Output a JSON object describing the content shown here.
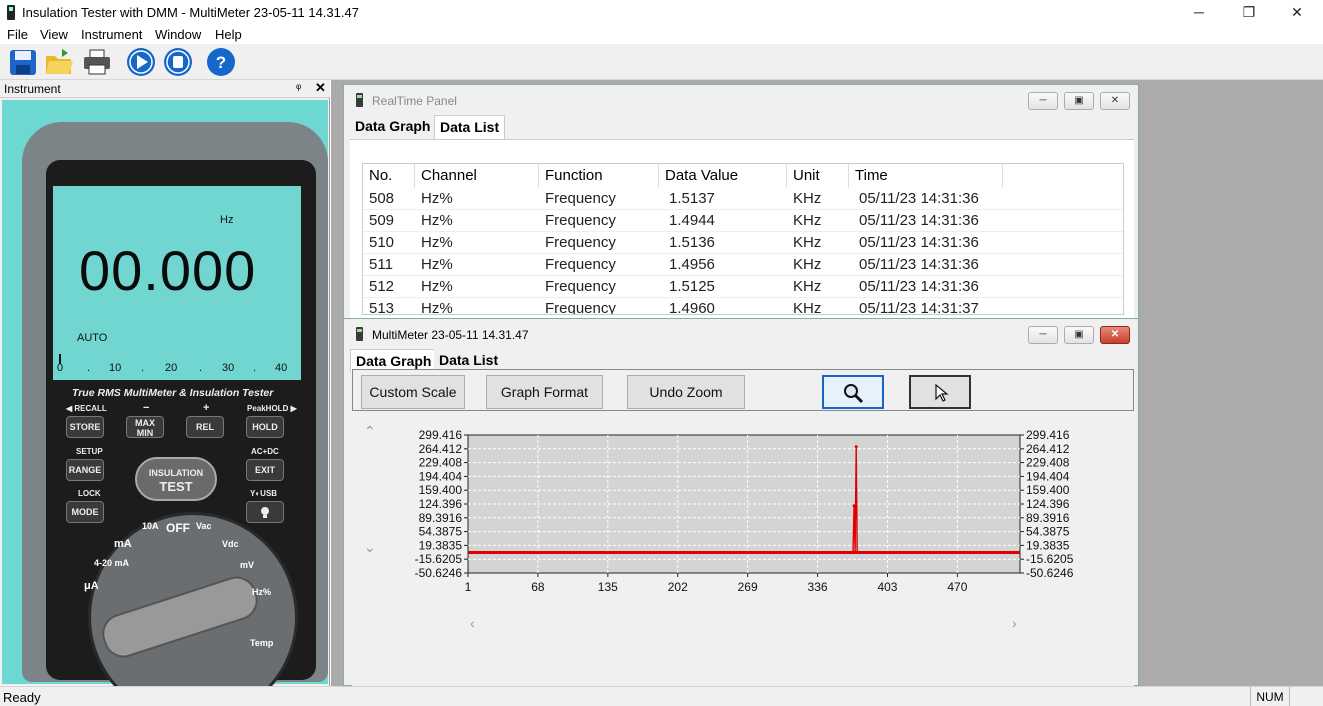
{
  "window": {
    "title": "Insulation Tester with DMM - MultiMeter 23-05-11  14.31.47",
    "minimize": "─",
    "maximize": "❐",
    "close": "✕"
  },
  "menu": [
    "File",
    "View",
    "Instrument",
    "Window",
    "Help"
  ],
  "toolbar_icons": [
    "save-icon",
    "open-folder-icon",
    "print-icon",
    "play-icon",
    "stop-icon",
    "help-icon"
  ],
  "instrument_pane": {
    "title": "Instrument",
    "pin": "ᵠ",
    "close": "✕",
    "lcd": {
      "unit": "Hz",
      "reading": "00.000",
      "mode": "AUTO",
      "scale": [
        "0",
        ".",
        "10",
        ".",
        "20",
        ".",
        "30",
        ".",
        "40"
      ]
    },
    "brand": "True RMS MultiMeter & Insulation Tester",
    "labels": {
      "recall": "◀ RECALL",
      "minus": "−",
      "plus": "+",
      "peakhold": "PeakHOLD ▶",
      "setup": "SETUP",
      "acdc": "AC+DC",
      "lock": "LOCK",
      "usb": "Y◐USB"
    },
    "buttons": {
      "store": "STORE",
      "maxmin": "MAX MIN",
      "rel": "REL",
      "hold": "HOLD",
      "range": "RANGE",
      "exit": "EXIT",
      "mode": "MODE"
    },
    "insulation": {
      "line1": "INSULATION",
      "line2": "TEST"
    },
    "dial": [
      "OFF",
      "10A",
      "Vac",
      "Vdc",
      "mV",
      "Hz%",
      "mA",
      "4-20 mA",
      "μA",
      "Temp"
    ]
  },
  "realtime_panel": {
    "title": "RealTime Panel",
    "tabs": [
      "Data Graph",
      "Data List"
    ],
    "active_tab": "Data List",
    "columns": [
      "No.",
      "Channel",
      "Function",
      "Data Value",
      "Unit",
      "Time"
    ],
    "rows": [
      [
        "508",
        "Hz%",
        "Frequency",
        "1.5137",
        "KHz",
        "05/11/23 14:31:36"
      ],
      [
        "509",
        "Hz%",
        "Frequency",
        "1.4944",
        "KHz",
        "05/11/23 14:31:36"
      ],
      [
        "510",
        "Hz%",
        "Frequency",
        "1.5136",
        "KHz",
        "05/11/23 14:31:36"
      ],
      [
        "511",
        "Hz%",
        "Frequency",
        "1.4956",
        "KHz",
        "05/11/23 14:31:36"
      ],
      [
        "512",
        "Hz%",
        "Frequency",
        "1.5125",
        "KHz",
        "05/11/23 14:31:36"
      ],
      [
        "513",
        "Hz%",
        "Frequency",
        "1.4960",
        "KHz",
        "05/11/23 14:31:37"
      ]
    ]
  },
  "multimeter_window": {
    "title": "MultiMeter 23-05-11  14.31.47",
    "tabs": [
      "Data Graph",
      "Data List"
    ],
    "active_tab": "Data Graph",
    "buttons": {
      "custom_scale": "Custom Scale",
      "graph_format": "Graph Format",
      "undo_zoom": "Undo Zoom"
    },
    "tool_icons": [
      "zoom-icon",
      "pointer-icon"
    ],
    "scroll": {
      "up": "⌃",
      "down": "⌄",
      "left": "‹",
      "right": "›"
    }
  },
  "chart_data": {
    "type": "line",
    "title": "",
    "xlabel": "",
    "ylabel": "",
    "y_ticks": [
      "299.416",
      "264.412",
      "229.408",
      "194.404",
      "159.400",
      "124.396",
      "89.3916",
      "54.3875",
      "19.3835",
      "-15.6205",
      "-50.6246"
    ],
    "x_ticks": [
      "1",
      "68",
      "135",
      "202",
      "269",
      "336",
      "403",
      "470"
    ],
    "xlim": [
      1,
      530
    ],
    "ylim": [
      -50.6246,
      299.416
    ],
    "grid": true,
    "series": [
      {
        "color": "#e00000",
        "points": [
          [
            1,
            1.51
          ],
          [
            370,
            1.51
          ],
          [
            371,
            120
          ],
          [
            372,
            1.51
          ],
          [
            373,
            270
          ],
          [
            374,
            1.51
          ],
          [
            530,
            1.51
          ]
        ]
      }
    ]
  },
  "status": {
    "text": "Ready",
    "num": "NUM"
  }
}
